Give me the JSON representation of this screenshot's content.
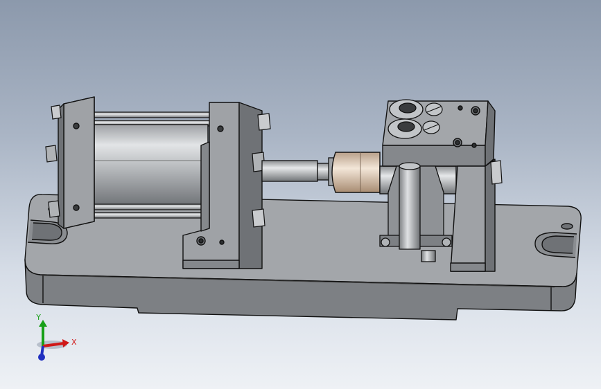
{
  "viewport": {
    "background_top": "#8c99ac",
    "background_bottom": "#eef1f5"
  },
  "model": {
    "base_color": "#8f9296",
    "part_color": "#9a9da1",
    "metal_color": "#c7cacc",
    "bronze_color": "#d8c0a8",
    "edge_color": "#111111"
  },
  "triad": {
    "x_label": "X",
    "y_label": "Y",
    "x_color": "#d01818",
    "y_color": "#18a018",
    "z_color": "#2030c0"
  }
}
